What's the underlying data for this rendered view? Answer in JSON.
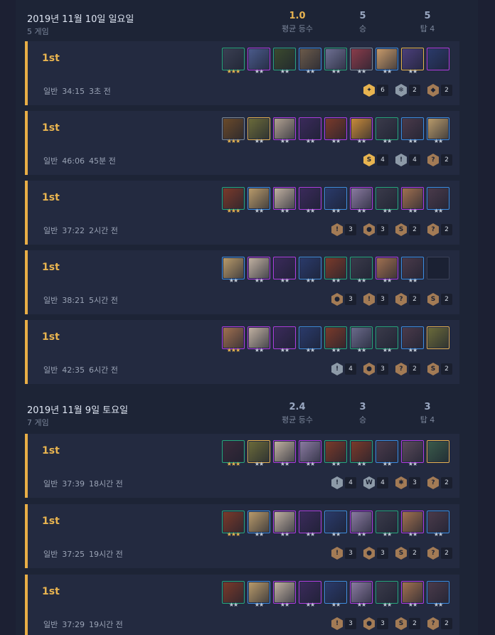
{
  "days": [
    {
      "title": "2019년 11월 10일 일요일",
      "games": "5 게임",
      "avg_rank": "1.0",
      "avg_rank_label": "평균 등수",
      "wins": "5",
      "wins_label": "승",
      "top4": "5",
      "top4_label": "탑 4",
      "matches": [
        {
          "place": "1st",
          "mode": "일반",
          "duration": "34:15",
          "ago": "3초 전",
          "champions": [
            {
              "tier": 2,
              "stars": 3,
              "color": "#3a3f52"
            },
            {
              "tier": 4,
              "stars": 2,
              "color": "#4a5a8a"
            },
            {
              "tier": 2,
              "stars": 2,
              "color": "#3b4a2e"
            },
            {
              "tier": 3,
              "stars": 2,
              "color": "#6b5a4a"
            },
            {
              "tier": 2,
              "stars": 2,
              "color": "#6e6f92"
            },
            {
              "tier": 1,
              "stars": 2,
              "color": "#8a3c4a"
            },
            {
              "tier": 3,
              "stars": 2,
              "color": "#c79a6a"
            },
            {
              "tier": 5,
              "stars": 2,
              "color": "#4b3f7a"
            },
            {
              "tier": 4,
              "stars": 0,
              "color": "#2b3a6a"
            }
          ],
          "traits": [
            {
              "icon": "blademaster-icon",
              "level": "gold",
              "count": "6"
            },
            {
              "icon": "glacial-icon",
              "level": "silver",
              "count": "2"
            },
            {
              "icon": "ninja-icon",
              "level": "bronze",
              "count": "2"
            }
          ]
        },
        {
          "place": "1st",
          "mode": "일반",
          "duration": "46:06",
          "ago": "45분 전",
          "champions": [
            {
              "tier": 1,
              "stars": 3,
              "color": "#6a4a2a"
            },
            {
              "tier": 5,
              "stars": 2,
              "color": "#6a6a3a"
            },
            {
              "tier": 4,
              "stars": 2,
              "color": "#b0a090"
            },
            {
              "tier": 4,
              "stars": 2,
              "color": "#3a2a5a"
            },
            {
              "tier": 4,
              "stars": 2,
              "color": "#7a3a2a"
            },
            {
              "tier": 4,
              "stars": 2,
              "color": "#c88a3a"
            },
            {
              "tier": 2,
              "stars": 2,
              "color": "#3a3a4a"
            },
            {
              "tier": 3,
              "stars": 2,
              "color": "#4a3a4a"
            },
            {
              "tier": 3,
              "stars": 2,
              "color": "#b89a6a"
            }
          ],
          "traits": [
            {
              "icon": "shapeshifter-icon",
              "level": "gold",
              "count": "4"
            },
            {
              "icon": "imperial-icon",
              "level": "silver",
              "count": "4"
            },
            {
              "icon": "assassin-icon",
              "level": "bronze",
              "count": "2"
            }
          ]
        },
        {
          "place": "1st",
          "mode": "일반",
          "duration": "37:22",
          "ago": "2시간 전",
          "champions": [
            {
              "tier": 2,
              "stars": 3,
              "color": "#7a3a2a"
            },
            {
              "tier": 3,
              "stars": 2,
              "color": "#b89a6a"
            },
            {
              "tier": 4,
              "stars": 2,
              "color": "#c0b0a0"
            },
            {
              "tier": 4,
              "stars": 2,
              "color": "#3a2a5a"
            },
            {
              "tier": 3,
              "stars": 2,
              "color": "#2a3a6a"
            },
            {
              "tier": 4,
              "stars": 2,
              "color": "#8a7aa0"
            },
            {
              "tier": 2,
              "stars": 2,
              "color": "#3a3a4a"
            },
            {
              "tier": 4,
              "stars": 2,
              "color": "#a07050"
            },
            {
              "tier": 3,
              "stars": 2,
              "color": "#4a3a4a"
            }
          ],
          "traits": [
            {
              "icon": "imperial-icon",
              "level": "bronze",
              "count": "3"
            },
            {
              "icon": "void-icon",
              "level": "bronze",
              "count": "3"
            },
            {
              "icon": "shapeshifter-icon",
              "level": "bronze",
              "count": "2"
            },
            {
              "icon": "assassin-icon",
              "level": "bronze",
              "count": "2"
            }
          ]
        },
        {
          "place": "1st",
          "mode": "일반",
          "duration": "38:21",
          "ago": "5시간 전",
          "champions": [
            {
              "tier": 3,
              "stars": 2,
              "color": "#b89a6a"
            },
            {
              "tier": 4,
              "stars": 2,
              "color": "#c0b0a0"
            },
            {
              "tier": 4,
              "stars": 2,
              "color": "#3a2a5a"
            },
            {
              "tier": 3,
              "stars": 2,
              "color": "#2a3a6a"
            },
            {
              "tier": 2,
              "stars": 2,
              "color": "#7a3a2a"
            },
            {
              "tier": 2,
              "stars": 2,
              "color": "#3a3a4a"
            },
            {
              "tier": 4,
              "stars": 2,
              "color": "#a07050"
            },
            {
              "tier": 3,
              "stars": 2,
              "color": "#4a3a4a"
            },
            {
              "tier": 0,
              "stars": 0,
              "color": "#1b2133"
            }
          ],
          "traits": [
            {
              "icon": "void-icon",
              "level": "bronze",
              "count": "3"
            },
            {
              "icon": "imperial-icon",
              "level": "bronze",
              "count": "3"
            },
            {
              "icon": "assassin-icon",
              "level": "bronze",
              "count": "2"
            },
            {
              "icon": "shapeshifter-icon",
              "level": "bronze",
              "count": "2"
            }
          ]
        },
        {
          "place": "1st",
          "mode": "일반",
          "duration": "42:35",
          "ago": "6시간 전",
          "champions": [
            {
              "tier": 4,
              "stars": 3,
              "color": "#a07050"
            },
            {
              "tier": 4,
              "stars": 2,
              "color": "#c0b0a0"
            },
            {
              "tier": 4,
              "stars": 2,
              "color": "#3a2a5a"
            },
            {
              "tier": 3,
              "stars": 2,
              "color": "#2a3a6a"
            },
            {
              "tier": 2,
              "stars": 2,
              "color": "#7a3a2a"
            },
            {
              "tier": 2,
              "stars": 2,
              "color": "#6a6a8a"
            },
            {
              "tier": 2,
              "stars": 2,
              "color": "#3a3a4a"
            },
            {
              "tier": 3,
              "stars": 2,
              "color": "#4a3a4a"
            },
            {
              "tier": 5,
              "stars": 0,
              "color": "#6a6a3a"
            }
          ],
          "traits": [
            {
              "icon": "imperial-icon",
              "level": "silver",
              "count": "4"
            },
            {
              "icon": "void-icon",
              "level": "bronze",
              "count": "3"
            },
            {
              "icon": "assassin-icon",
              "level": "bronze",
              "count": "2"
            },
            {
              "icon": "shapeshifter-icon",
              "level": "bronze",
              "count": "2"
            }
          ]
        }
      ]
    },
    {
      "title": "2019년 11월 9일 토요일",
      "games": "7 게임",
      "avg_rank": "2.4",
      "avg_rank_label": "평균 등수",
      "wins": "3",
      "wins_label": "승",
      "top4": "3",
      "top4_label": "탑 4",
      "matches": [
        {
          "place": "1st",
          "mode": "일반",
          "duration": "37:39",
          "ago": "18시간 전",
          "champions": [
            {
              "tier": 2,
              "stars": 3,
              "color": "#3a2a3a"
            },
            {
              "tier": 5,
              "stars": 2,
              "color": "#6a6a3a"
            },
            {
              "tier": 4,
              "stars": 2,
              "color": "#c0b0a0"
            },
            {
              "tier": 4,
              "stars": 2,
              "color": "#8a7aa0"
            },
            {
              "tier": 2,
              "stars": 2,
              "color": "#7a3a2a"
            },
            {
              "tier": 2,
              "stars": 2,
              "color": "#7a3a2a"
            },
            {
              "tier": 3,
              "stars": 2,
              "color": "#4a3a4a"
            },
            {
              "tier": 4,
              "stars": 2,
              "color": "#5a4a5a"
            },
            {
              "tier": 5,
              "stars": 0,
              "color": "#3a5a4a"
            }
          ],
          "traits": [
            {
              "icon": "imperial-icon",
              "level": "silver",
              "count": "4"
            },
            {
              "icon": "noble-icon",
              "level": "silver",
              "count": "4"
            },
            {
              "icon": "elementalist-icon",
              "level": "bronze",
              "count": "3"
            },
            {
              "icon": "assassin-icon",
              "level": "bronze",
              "count": "2"
            }
          ]
        },
        {
          "place": "1st",
          "mode": "일반",
          "duration": "37:25",
          "ago": "19시간 전",
          "champions": [
            {
              "tier": 2,
              "stars": 3,
              "color": "#7a3a2a"
            },
            {
              "tier": 3,
              "stars": 2,
              "color": "#b89a6a"
            },
            {
              "tier": 4,
              "stars": 2,
              "color": "#c0b0a0"
            },
            {
              "tier": 4,
              "stars": 2,
              "color": "#3a2a5a"
            },
            {
              "tier": 3,
              "stars": 2,
              "color": "#2a3a6a"
            },
            {
              "tier": 4,
              "stars": 2,
              "color": "#8a7aa0"
            },
            {
              "tier": 2,
              "stars": 2,
              "color": "#3a3a4a"
            },
            {
              "tier": 4,
              "stars": 2,
              "color": "#a07050"
            },
            {
              "tier": 3,
              "stars": 2,
              "color": "#4a3a4a"
            }
          ],
          "traits": [
            {
              "icon": "imperial-icon",
              "level": "bronze",
              "count": "3"
            },
            {
              "icon": "void-icon",
              "level": "bronze",
              "count": "3"
            },
            {
              "icon": "shapeshifter-icon",
              "level": "bronze",
              "count": "2"
            },
            {
              "icon": "assassin-icon",
              "level": "bronze",
              "count": "2"
            }
          ]
        },
        {
          "place": "1st",
          "mode": "일반",
          "duration": "37:29",
          "ago": "19시간 전",
          "champions": [
            {
              "tier": 2,
              "stars": 2,
              "color": "#7a3a2a"
            },
            {
              "tier": 3,
              "stars": 2,
              "color": "#b89a6a"
            },
            {
              "tier": 4,
              "stars": 2,
              "color": "#c0b0a0"
            },
            {
              "tier": 4,
              "stars": 2,
              "color": "#3a2a5a"
            },
            {
              "tier": 3,
              "stars": 2,
              "color": "#2a3a6a"
            },
            {
              "tier": 4,
              "stars": 2,
              "color": "#8a7aa0"
            },
            {
              "tier": 2,
              "stars": 2,
              "color": "#3a3a4a"
            },
            {
              "tier": 4,
              "stars": 2,
              "color": "#a07050"
            },
            {
              "tier": 3,
              "stars": 2,
              "color": "#4a3a4a"
            }
          ],
          "traits": [
            {
              "icon": "imperial-icon",
              "level": "bronze",
              "count": "3"
            },
            {
              "icon": "void-icon",
              "level": "bronze",
              "count": "3"
            },
            {
              "icon": "shapeshifter-icon",
              "level": "bronze",
              "count": "2"
            },
            {
              "icon": "assassin-icon",
              "level": "bronze",
              "count": "2"
            }
          ]
        }
      ]
    }
  ]
}
